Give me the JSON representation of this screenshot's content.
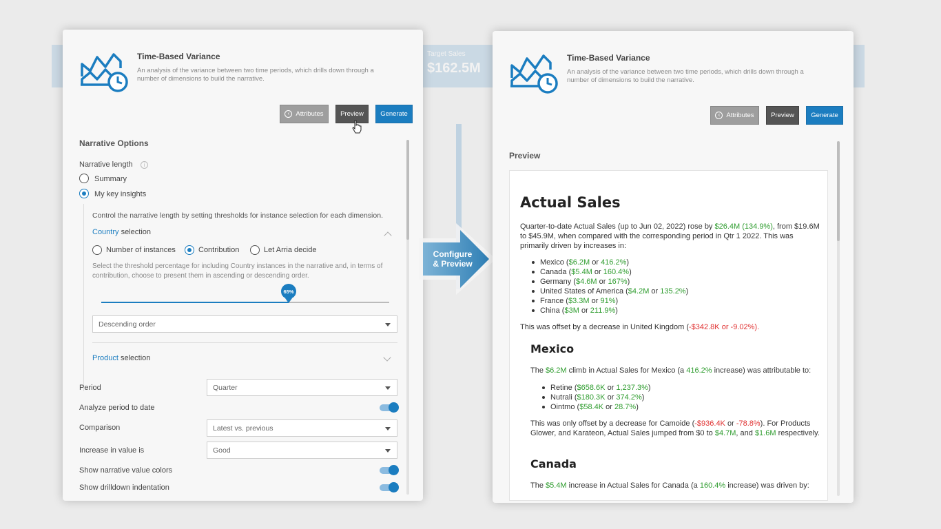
{
  "background": {
    "kpi_title": "Target Sales",
    "kpi_value": "$162.5M"
  },
  "left": {
    "title": "Time-Based Variance",
    "description": "An analysis of the variance between two time periods, which drills down through a number of dimensions to build the narrative.",
    "buttons": {
      "attributes": "Attributes",
      "preview": "Preview",
      "generate": "Generate"
    },
    "narrative_options": "Narrative Options",
    "narrative_length_label": "Narrative length",
    "radio_summary": "Summary",
    "radio_key_insights": "My key insights",
    "control_hint": "Control the narrative length by setting thresholds for instance selection for each dimension.",
    "country_word": "Country",
    "selection_word": "selection",
    "opt_instances": "Number of instances",
    "opt_contribution": "Contribution",
    "opt_arria": "Let Arria decide",
    "threshold_hint": "Select the threshold percentage for including Country instances in the narrative and, in terms of contribution, choose to present them in ascending or descending order.",
    "slider_label": "65%",
    "slider_value": 0.65,
    "order_select": "Descending order",
    "product_word": "Product",
    "period_label": "Period",
    "period_value": "Quarter",
    "analyze_label": "Analyze period to date",
    "comparison_label": "Comparison",
    "comparison_value": "Latest vs. previous",
    "increase_label": "Increase in value is",
    "increase_value": "Good",
    "colors_label": "Show narrative value colors",
    "indent_label": "Show drilldown indentation"
  },
  "arrow": {
    "line1": "Configure",
    "line2": "& Preview"
  },
  "right": {
    "title": "Time-Based Variance",
    "description": "An analysis of the variance between two time periods, which drills down through a number of dimensions to build the narrative.",
    "buttons": {
      "attributes": "Attributes",
      "preview": "Preview",
      "generate": "Generate"
    },
    "preview_label": "Preview",
    "doc": {
      "h1": "Actual Sales",
      "intro_a": "Quarter-to-date Actual Sales (up to Jun 02, 2022) rose by ",
      "intro_b": "$26.4M (134.9%)",
      "intro_c": ", from $19.6M to $45.9M, when compared with the corresponding period in Qtr 1 2022. This was primarily driven by increases in:",
      "countries": [
        {
          "name": "Mexico",
          "v1": "$6.2M",
          "v2": "416.2%"
        },
        {
          "name": "Canada",
          "v1": "$5.4M",
          "v2": "160.4%"
        },
        {
          "name": "Germany",
          "v1": "$4.6M",
          "v2": "167%"
        },
        {
          "name": "United States of America",
          "v1": "$4.2M",
          "v2": "135.2%"
        },
        {
          "name": "France",
          "v1": "$3.3M",
          "v2": "91%"
        },
        {
          "name": "China",
          "v1": "$3M",
          "v2": "211.9%"
        }
      ],
      "offset_a": "This was offset by a decrease in United Kingdom (",
      "offset_v1": "-$342.8K",
      "offset_or": " or ",
      "offset_v2": "-9.02%",
      "offset_end": ").",
      "h2_mexico": "Mexico",
      "mex_a": "The ",
      "mex_v1": "$6.2M",
      "mex_b": " climb in Actual Sales for Mexico (a ",
      "mex_v2": "416.2%",
      "mex_c": " increase) was attributable to:",
      "products": [
        {
          "name": "Retine",
          "v1": "$658.6K",
          "v2": "1,237.3%"
        },
        {
          "name": "Nutrali",
          "v1": "$180.3K",
          "v2": "374.2%"
        },
        {
          "name": "Ointmo",
          "v1": "$58.4K",
          "v2": "28.7%"
        }
      ],
      "camo_a": "This was only offset by a decrease for Camoide (",
      "camo_v1": "-$936.4K",
      "camo_v2": "-78.8%",
      "camo_b": "). For Products Glower, and Karateon, Actual Sales jumped from $0 to ",
      "camo_v3": "$4.7M",
      "camo_and": ", and ",
      "camo_v4": "$1.6M",
      "camo_end": " respectively.",
      "h2_canada": "Canada",
      "can_a": "The ",
      "can_v1": "$5.4M",
      "can_b": " increase in Actual Sales for Canada (a ",
      "can_v2": "160.4%",
      "can_c": " increase) was driven by:"
    }
  },
  "colors": {
    "accent": "#1b7dc0",
    "positive": "#2e9c2e",
    "negative": "#e03030"
  }
}
